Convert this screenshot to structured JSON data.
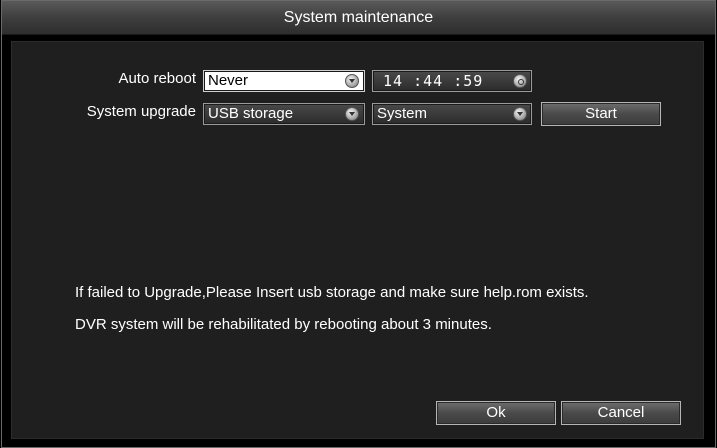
{
  "window": {
    "title": "System maintenance"
  },
  "auto_reboot": {
    "label": "Auto reboot",
    "value": "Never",
    "time": "14 :44 :59"
  },
  "system_upgrade": {
    "label": "System upgrade",
    "source": "USB storage",
    "target": "System",
    "start_label": "Start"
  },
  "messages": {
    "line1": "If failed to Upgrade,Please Insert usb storage and make sure help.rom exists.",
    "line2": "DVR system will be rehabilitated by rebooting about 3 minutes."
  },
  "footer": {
    "ok_label": "Ok",
    "cancel_label": "Cancel"
  },
  "icons": [
    "dropdown-icon",
    "clock-icon"
  ]
}
